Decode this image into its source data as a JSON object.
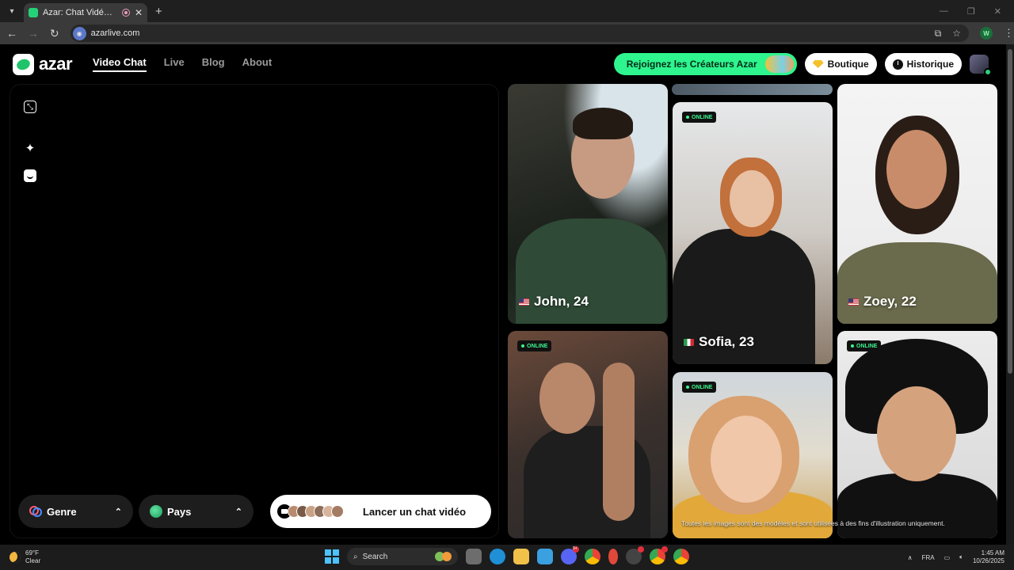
{
  "browser": {
    "tab_title": "Azar: Chat Vidéo, Rencontr",
    "tab_close": "✕",
    "new_tab": "+",
    "url": "azarlive.com",
    "profile_initial": "W",
    "back": "←",
    "forward": "→",
    "reload": "↻",
    "menu": "⋮",
    "window_minimize": "—",
    "window_restore": "❐",
    "window_close": "✕"
  },
  "header": {
    "logo_text": "azar",
    "nav": [
      "Video Chat",
      "Live",
      "Blog",
      "About"
    ],
    "join_label": "Rejoignez les Créateurs Azar",
    "shop_label": "Boutique",
    "history_label": "Historique"
  },
  "controls": {
    "genre_label": "Genre",
    "country_label": "Pays",
    "chevron": "⌃",
    "launch_label": "Lancer un chat vidéo"
  },
  "gallery": {
    "online_label": "ONLINE",
    "cards": [
      {
        "name": "John, 24",
        "flag": "US",
        "online": false
      },
      {
        "name": "Sofia, 23",
        "flag": "IT",
        "online": true
      },
      {
        "name": "Zoey, 22",
        "flag": "US",
        "online": false
      },
      {
        "name": "",
        "flag": "",
        "online": true
      },
      {
        "name": "",
        "flag": "",
        "online": true
      },
      {
        "name": "",
        "flag": "",
        "online": true
      }
    ],
    "disclaimer": "Toutes les images sont des modèles et sont utilisées à des fins d'illustration uniquement."
  },
  "taskbar": {
    "temperature": "69°F",
    "condition": "Clear",
    "search_placeholder": "Search",
    "language": "FRA",
    "time": "1:45 AM",
    "date": "10/26/2025",
    "chevron": "∧",
    "discord_badge": "9+"
  },
  "colors": {
    "accent": "#2ef58e",
    "online_green": "#3df58e",
    "taskbar_bg": "#1c1c1c"
  }
}
